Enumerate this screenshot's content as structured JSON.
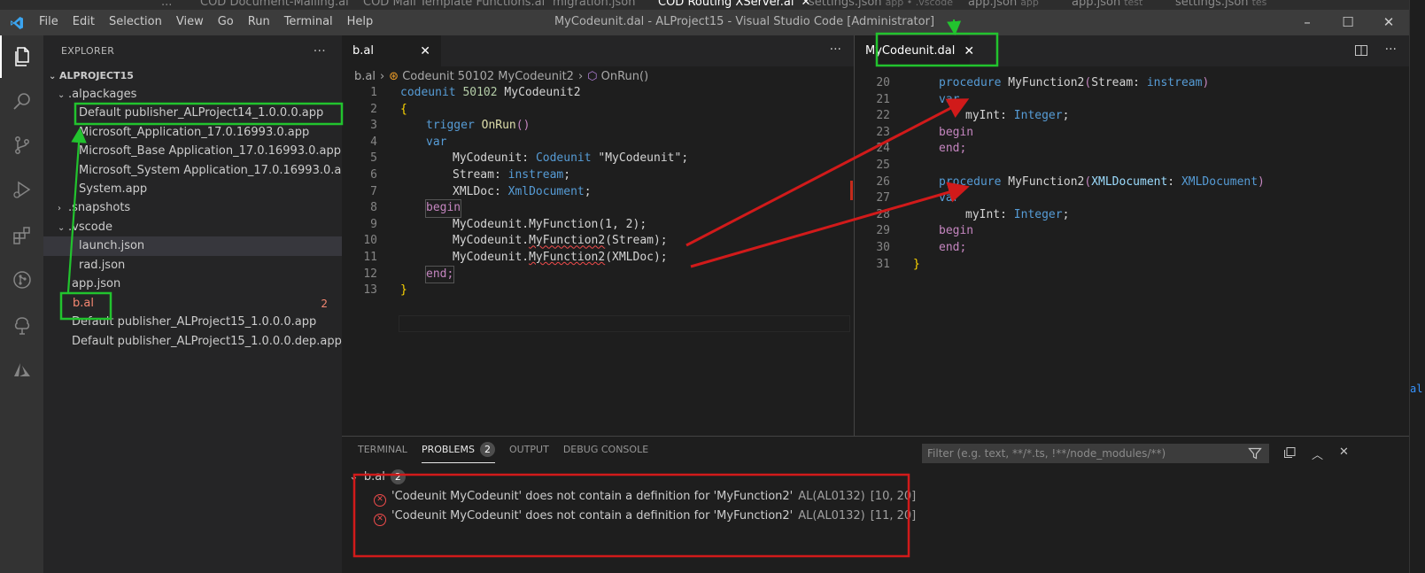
{
  "background_tabs": [
    {
      "label": "...",
      "sub": ""
    },
    {
      "label": "COD Document-Mailing.al",
      "sub": ""
    },
    {
      "label": "COD Mail Template Functions.al",
      "sub": ""
    },
    {
      "label": "migration.json",
      "sub": ""
    },
    {
      "label": "COD Routing XServer.al",
      "sub": ""
    },
    {
      "label": "settings.json",
      "sub": "app • .vscode"
    },
    {
      "label": "app.json",
      "sub": "app"
    },
    {
      "label": "app.json",
      "sub": "test"
    },
    {
      "label": "settings.json",
      "sub": "tes"
    }
  ],
  "titlebar": {
    "menu": [
      "File",
      "Edit",
      "Selection",
      "View",
      "Go",
      "Run",
      "Terminal",
      "Help"
    ],
    "title": "MyCodeunit.dal - ALProject15 - Visual Studio Code [Administrator]",
    "minimize": "–",
    "maximize": "☐",
    "close": "✕"
  },
  "colors": {
    "accent": "#007acc",
    "error": "#f14c4c",
    "green_annotation": "#22c32e",
    "red_annotation": "#d11a1a"
  },
  "activity_icons": [
    "explorer-icon",
    "search-icon",
    "source-control-icon",
    "run-debug-icon",
    "extensions-icon",
    "git-icon",
    "tree-icon",
    "azure-icon"
  ],
  "explorer": {
    "header": "EXPLORER",
    "more": "···",
    "root": "ALPROJECT15",
    "items": [
      {
        "label": ".alpackages",
        "twisty": "⌄"
      },
      {
        "label": "Default publisher_ALProject14_1.0.0.0.app",
        "twisty": ""
      },
      {
        "label": "Microsoft_Application_17.0.16993.0.app",
        "twisty": ""
      },
      {
        "label": "Microsoft_Base Application_17.0.16993.0.app",
        "twisty": ""
      },
      {
        "label": "Microsoft_System Application_17.0.16993.0.app",
        "twisty": ""
      },
      {
        "label": "System.app",
        "twisty": ""
      },
      {
        "label": ".snapshots",
        "twisty": "›"
      },
      {
        "label": ".vscode",
        "twisty": "⌄"
      },
      {
        "label": "launch.json",
        "twisty": ""
      },
      {
        "label": "rad.json",
        "twisty": ""
      },
      {
        "label": "app.json",
        "twisty": ""
      },
      {
        "label": "b.al",
        "twisty": "",
        "count": "2"
      },
      {
        "label": "Default publisher_ALProject15_1.0.0.0.app",
        "twisty": ""
      },
      {
        "label": "Default publisher_ALProject15_1.0.0.0.dep.app",
        "twisty": ""
      }
    ]
  },
  "editor_left": {
    "tab": "b.al",
    "tab_close": "✕",
    "more": "···",
    "breadcrumb": [
      "b.al",
      "Codeunit 50102 MyCodeunit2",
      "OnRun()"
    ],
    "lines": [
      "1",
      "2",
      "3",
      "4",
      "5",
      "6",
      "7",
      "8",
      "9",
      "10",
      "11",
      "12",
      "13"
    ],
    "tokens": {
      "l1_kw": "codeunit",
      "l1_num": "50102",
      "l1_name": "MyCodeunit2",
      "l2": "{",
      "l3_kw": "trigger",
      "l3_fn": "OnRun",
      "l3_p": "()",
      "l4": "var",
      "l5_id": "MyCodeunit",
      "l5_colon": ": ",
      "l5_ty": "Codeunit",
      "l5_str": "\"MyCodeunit\"",
      "l5_end": ";",
      "l6_id": "Stream",
      "l6_colon": ": ",
      "l6_ty": "instream",
      "l6_end": ";",
      "l7_id": "XMLDoc",
      "l7_colon": ": ",
      "l7_ty": "XmlDocument",
      "l7_end": ";",
      "l8": "begin",
      "l9": "MyCodeunit.MyFunction(1, 2);",
      "l10_a": "MyCodeunit.",
      "l10_b": "MyFunction2",
      "l10_c": "(Stream);",
      "l11_a": "MyCodeunit.",
      "l11_b": "MyFunction2",
      "l11_c": "(XMLDoc);",
      "l12": "end;",
      "l13": "}"
    }
  },
  "editor_right": {
    "tab": "MyCodeunit.dal",
    "tab_close": "✕",
    "more": "···",
    "lines": [
      "20",
      "21",
      "22",
      "23",
      "24",
      "25",
      "26",
      "27",
      "28",
      "29",
      "30",
      "31"
    ],
    "tokens": {
      "p1_kw": "procedure",
      "p1_fn": "MyFunction2",
      "p1_a": "(Stream: ",
      "p1_ty": "instream",
      "p1_b": ")",
      "var": "var",
      "myint_id": "myInt",
      "myint_colon": ": ",
      "myint_ty": "Integer",
      "myint_end": ";",
      "begin": "begin",
      "end": "end;",
      "p2_kw": "procedure",
      "p2_fn": "MyFunction2",
      "p2_a": "(",
      "p2_param": "XMLDocument",
      "p2_colon": ": ",
      "p2_ty": "XMLDocument",
      "p2_b": ")",
      "close": "}"
    }
  },
  "panel": {
    "tabs": [
      "TERMINAL",
      "PROBLEMS",
      "OUTPUT",
      "DEBUG CONSOLE"
    ],
    "problems_count": "2",
    "filter_placeholder": "Filter (e.g. text, **/*.ts, !**/node_modules/**)",
    "file": "b.al",
    "file_count": "2",
    "problems": [
      {
        "message": "'Codeunit MyCodeunit' does not contain a definition for 'MyFunction2'",
        "source": "AL(AL0132)",
        "location": "[10, 20]"
      },
      {
        "message": "'Codeunit MyCodeunit' does not contain a definition for 'MyFunction2'",
        "source": "AL(AL0132)",
        "location": "[11, 20]"
      }
    ]
  }
}
